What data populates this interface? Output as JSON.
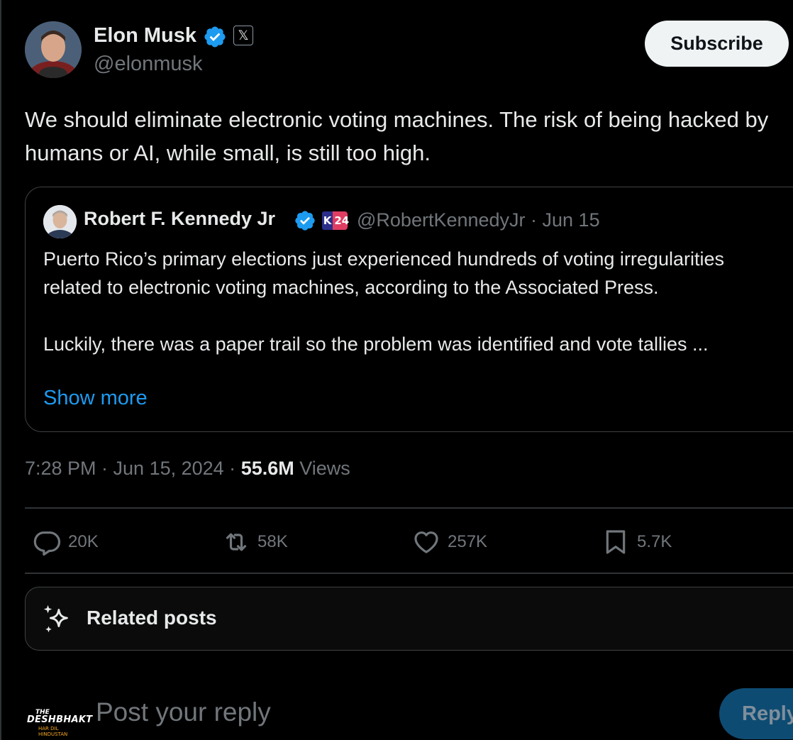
{
  "author": {
    "name": "Elon Musk",
    "handle": "@elonmusk",
    "verified_icon": "verified-badge-icon",
    "affiliation_icon": "x-logo-icon",
    "affiliation_glyph": "𝕏",
    "avatar": "profile-photo"
  },
  "header": {
    "subscribe_label": "Subscribe"
  },
  "post": {
    "text": "We should eliminate electronic voting machines. The risk of being hacked by humans or AI, while small, is still too high."
  },
  "quote": {
    "name": "Robert F. Kennedy Jr",
    "affiliation_label": {
      "k": "K",
      "n": "24"
    },
    "handle_date": "@RobertKennedyJr · Jun 15",
    "paragraph_1": "Puerto Rico’s primary elections just experienced hundreds of voting irregularities related to electronic voting machines, according to the Associated Press.",
    "paragraph_2": "Luckily, there was a paper trail so the problem was identified and vote tallies ...",
    "show_more": "Show more"
  },
  "meta": {
    "time_date": "7:28 PM · Jun 15, 2024 · ",
    "views_count": "55.6M",
    "views_label": " Views"
  },
  "actions": {
    "replies": {
      "icon": "reply-icon",
      "count": "20K"
    },
    "reposts": {
      "icon": "repost-icon",
      "count": "58K"
    },
    "likes": {
      "icon": "heart-icon",
      "count": "257K"
    },
    "bookmarks": {
      "icon": "bookmark-icon",
      "count": "5.7K"
    }
  },
  "related": {
    "icon": "sparkle-icon",
    "label": "Related posts"
  },
  "reply_bar": {
    "avatar_text": {
      "line1": "THE",
      "line2": "DESHBHAKT",
      "line3": "HAR DIL HINDUSTAN"
    },
    "placeholder": "Post your reply",
    "button_label": "Reply"
  },
  "colors": {
    "background": "#000000",
    "text": "#e7e9ea",
    "secondary_text": "#71767b",
    "link": "#1d9bf0",
    "verified": "#1d9bf0",
    "reply_button": "#0e4b72"
  }
}
